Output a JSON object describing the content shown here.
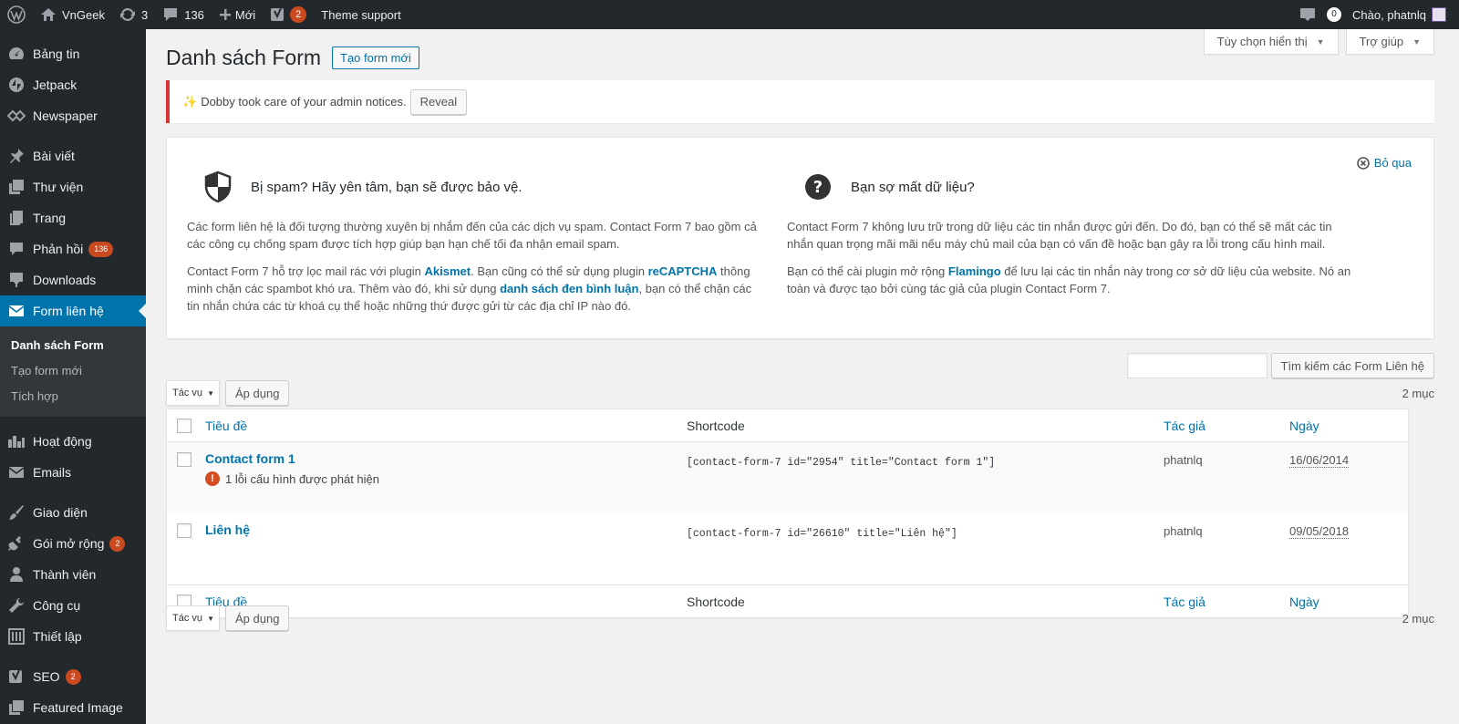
{
  "adminbar": {
    "site_name": "VnGeek",
    "updates_count": "3",
    "comments_count": "136",
    "new_label": "Mới",
    "yoast_count": "2",
    "theme_support": "Theme support",
    "notif_count": "0",
    "greeting": "Chào, phatnlq"
  },
  "sidebar": {
    "items": [
      {
        "label": "Bảng tin",
        "icon": "dashboard-icon"
      },
      {
        "label": "Jetpack",
        "icon": "jetpack-icon"
      },
      {
        "label": "Newspaper",
        "icon": "newspaper-icon"
      },
      {
        "label": "Bài viết",
        "icon": "pin-icon"
      },
      {
        "label": "Thư viện",
        "icon": "media-icon"
      },
      {
        "label": "Trang",
        "icon": "page-icon"
      },
      {
        "label": "Phản hồi",
        "icon": "comment-icon",
        "count": "136"
      },
      {
        "label": "Downloads",
        "icon": "download-icon"
      },
      {
        "label": "Form liên hệ",
        "icon": "mail-icon"
      },
      {
        "label": "Hoạt động",
        "icon": "activity-icon"
      },
      {
        "label": "Emails",
        "icon": "mail-icon"
      },
      {
        "label": "Giao diện",
        "icon": "brush-icon"
      },
      {
        "label": "Gói mở rộng",
        "icon": "plugin-icon",
        "count": "2"
      },
      {
        "label": "Thành viên",
        "icon": "user-icon"
      },
      {
        "label": "Công cụ",
        "icon": "wrench-icon"
      },
      {
        "label": "Thiết lập",
        "icon": "settings-icon"
      },
      {
        "label": "SEO",
        "icon": "yoast-icon",
        "count": "2"
      },
      {
        "label": "Featured Image",
        "icon": "image-icon"
      }
    ],
    "submenu": [
      "Danh sách Form",
      "Tạo form mới",
      "Tích hợp"
    ]
  },
  "screen": {
    "options_label": "Tùy chọn hiển thị",
    "help_label": "Trợ giúp"
  },
  "page": {
    "title": "Danh sách Form",
    "add_new": "Tạo form mới"
  },
  "notice": {
    "text": "Dobby took care of your admin notices.",
    "reveal": "Reveal"
  },
  "welcome": {
    "dismiss": "Bỏ qua",
    "left": {
      "heading": "Bị spam? Hãy yên tâm, bạn sẽ được bảo vệ.",
      "p1": "Các form liên hệ là đối tượng thường xuyên bị nhắm đến của các dịch vụ spam. Contact Form 7 bao gồm cả các công cụ chống spam được tích hợp giúp bạn hạn chế tối đa nhận email spam.",
      "p2_a": "Contact Form 7 hỗ trợ lọc mail rác với plugin ",
      "p2_link1": "Akismet",
      "p2_b": ". Bạn cũng có thể sử dụng plugin ",
      "p2_link2": "reCAPTCHA",
      "p2_c": " thông minh chặn các spambot khó ưa. Thêm vào đó, khi sử dụng ",
      "p2_link3": "danh sách đen bình luận",
      "p2_d": ", bạn có thể chặn các tin nhắn chứa các từ khoá cụ thể hoặc những thứ được gửi từ các địa chỉ IP nào đó."
    },
    "right": {
      "heading": "Bạn sợ mất dữ liệu?",
      "p1": "Contact Form 7 không lưu trữ trong dữ liệu các tin nhắn được gửi đến. Do đó, bạn có thể sẽ mất các tin nhắn quan trọng mãi mãi nếu máy chủ mail của bạn có vấn đề hoặc bạn gây ra lỗi trong cấu hình mail.",
      "p2_a": "Bạn có thể cài plugin mở rộng ",
      "p2_link": "Flamingo",
      "p2_b": " để lưu lại các tin nhắn này trong cơ sở dữ liệu của website. Nó an toàn và được tạo bởi cùng tác giả của plugin Contact Form 7."
    }
  },
  "search": {
    "button": "Tìm kiếm các Form Liên hệ"
  },
  "tablenav": {
    "bulk_label": "Tác vụ",
    "apply": "Áp dụng",
    "count": "2 mục"
  },
  "table": {
    "columns": {
      "title": "Tiêu đề",
      "shortcode": "Shortcode",
      "author": "Tác giả",
      "date": "Ngày"
    },
    "rows": [
      {
        "title": "Contact form 1",
        "error": "1 lỗi cấu hình được phát hiện",
        "shortcode": "[contact-form-7 id=\"2954\" title=\"Contact form 1\"]",
        "author": "phatnlq",
        "date": "16/06/2014"
      },
      {
        "title": "Liên hệ",
        "error": "",
        "shortcode": "[contact-form-7 id=\"26610\" title=\"Liên hệ\"]",
        "author": "phatnlq",
        "date": "09/05/2018"
      }
    ]
  }
}
